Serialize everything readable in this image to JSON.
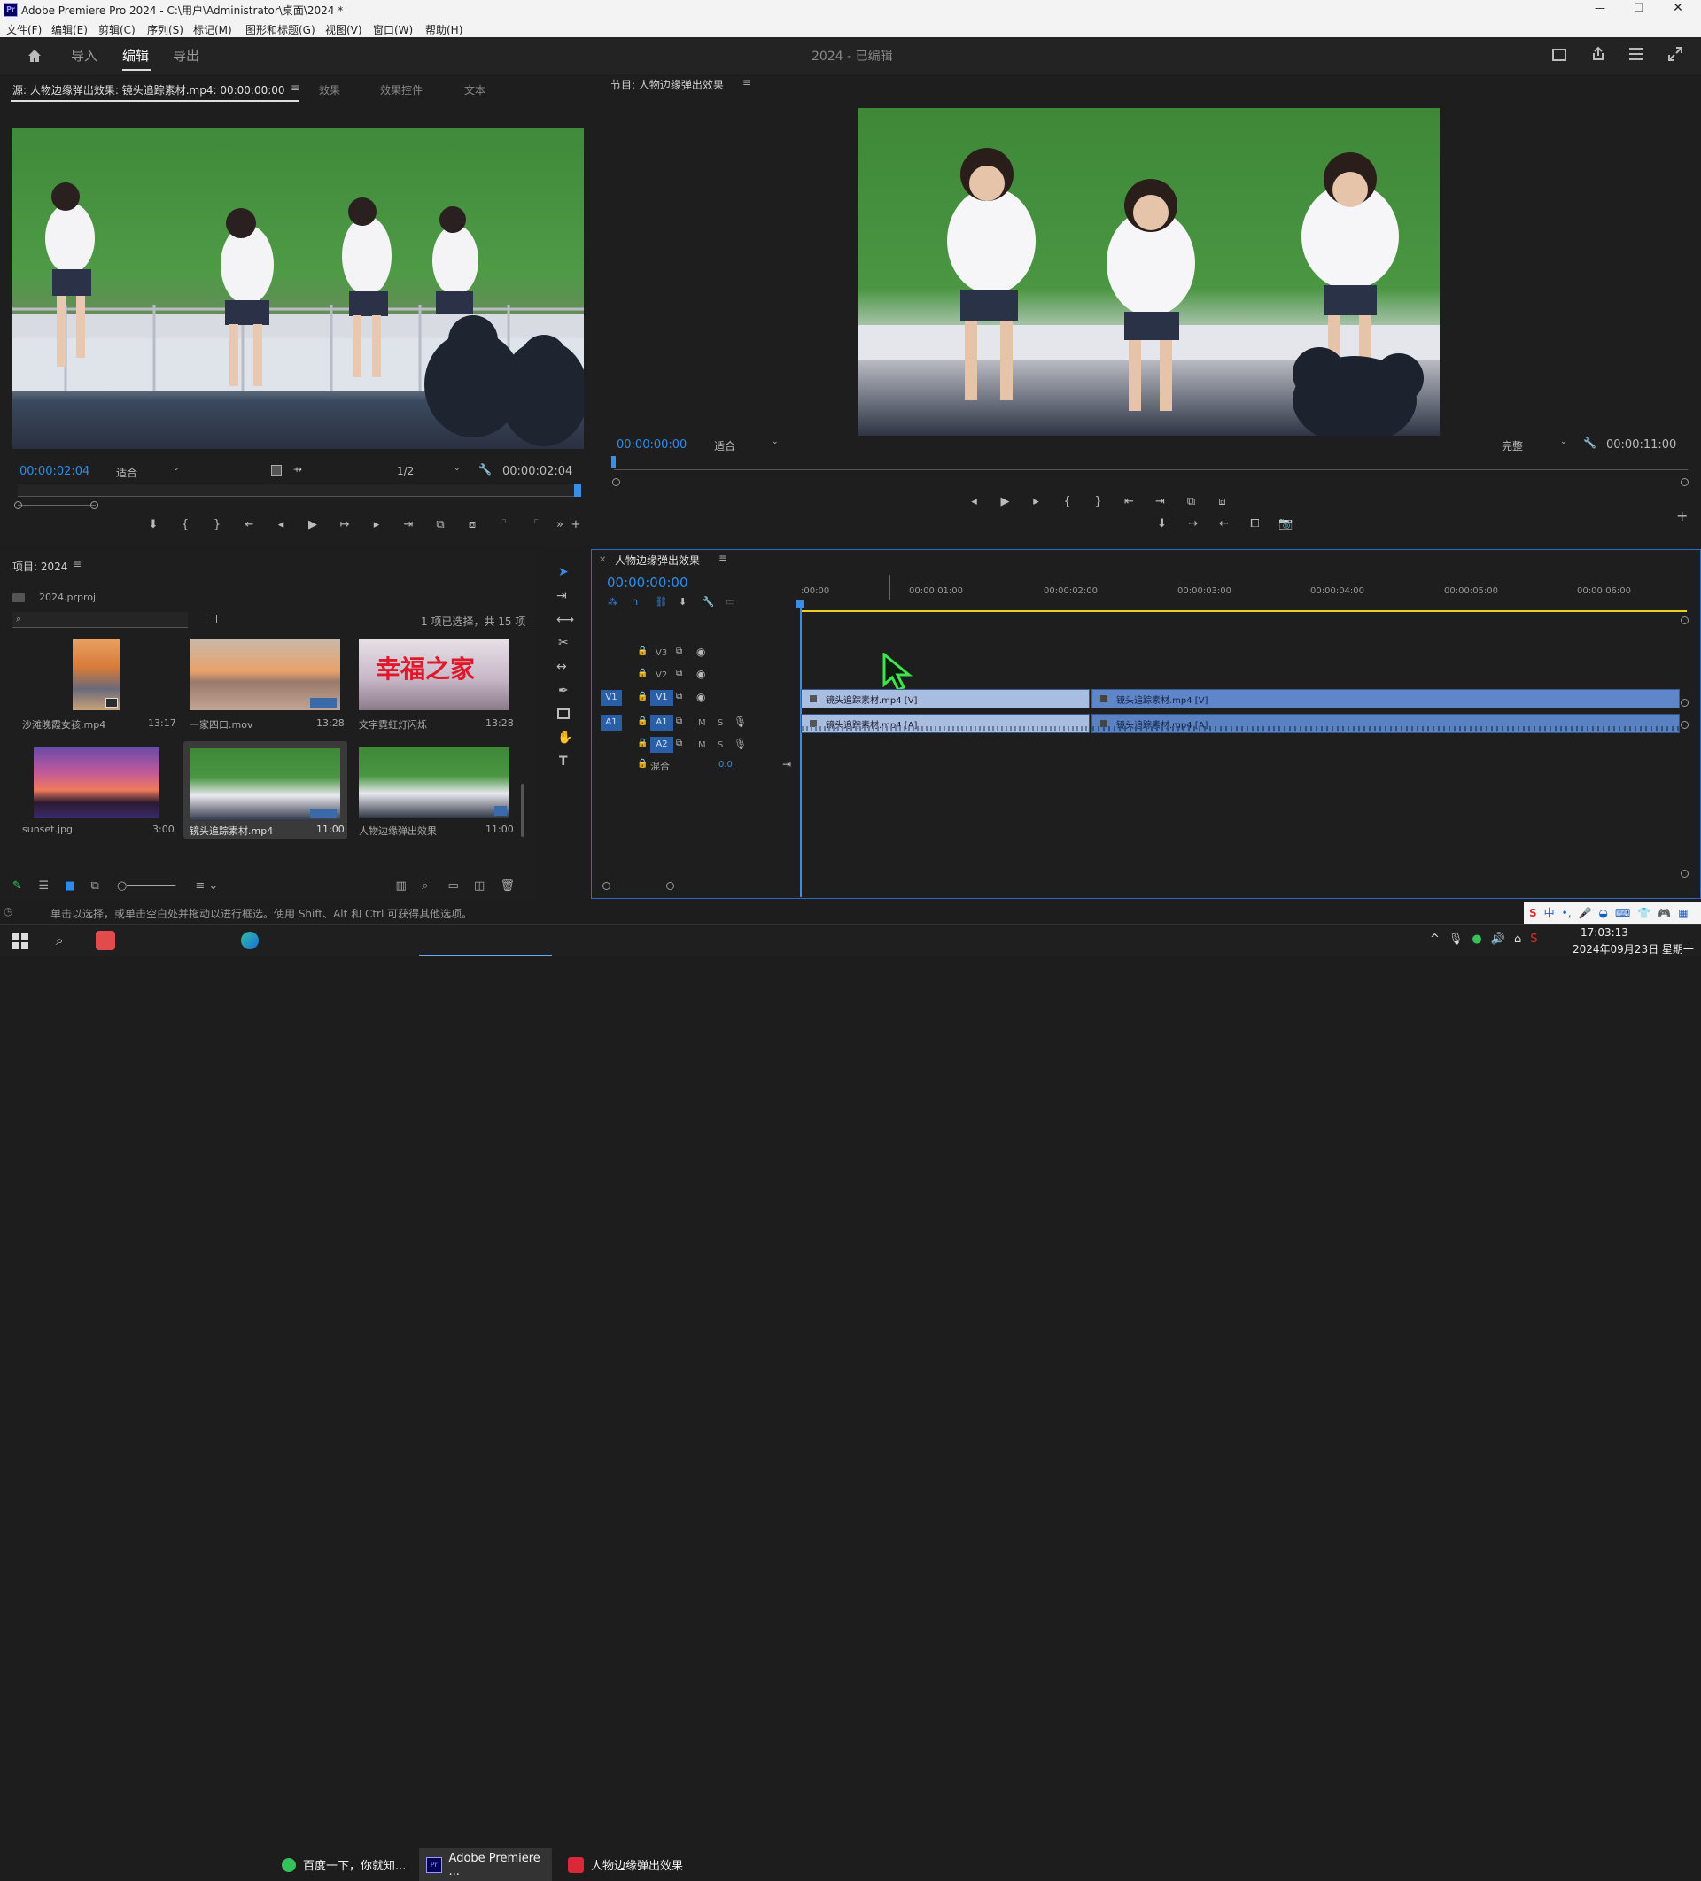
{
  "window": {
    "title": "Adobe Premiere Pro 2024 - C:\\用户\\Administrator\\桌面\\2024 *",
    "app_icon": "Pr"
  },
  "menu": [
    "文件(F)",
    "编辑(E)",
    "剪辑(C)",
    "序列(S)",
    "标记(M)",
    "图形和标题(G)",
    "视图(V)",
    "窗口(W)",
    "帮助(H)"
  ],
  "workspace": {
    "tabs": [
      "导入",
      "编辑",
      "导出"
    ],
    "active": "编辑",
    "project_status": "2024 - 已编辑"
  },
  "source": {
    "tabs": [
      "源: 人物边缘弹出效果: 镜头追踪素材.mp4: 00:00:00:00",
      "效果",
      "效果控件",
      "文本"
    ],
    "timecode": "00:00:02:04",
    "fit": "适合",
    "resolution": "1/2",
    "duration": "00:00:02:04"
  },
  "program": {
    "title": "节目: 人物边缘弹出效果",
    "timecode": "00:00:00:00",
    "fit": "适合",
    "quality": "完整",
    "duration": "00:00:11:00"
  },
  "project": {
    "title": "项目: 2024",
    "file": "2024.prproj",
    "selection": "1 项已选择，共 15 项",
    "search_placeholder": "",
    "items": [
      {
        "name": "沙滩晚霞女孩.mp4",
        "duration": "13:17"
      },
      {
        "name": "一家四口.mov",
        "duration": "13:28"
      },
      {
        "name": "文字霓虹灯闪烁",
        "duration": "13:28",
        "overlay": "幸福之家"
      },
      {
        "name": "sunset.jpg",
        "duration": "3:00"
      },
      {
        "name": "镜头追踪素材.mp4",
        "duration": "11:00"
      },
      {
        "name": "人物边缘弹出效果",
        "duration": "11:00"
      }
    ]
  },
  "timeline": {
    "title": "人物边缘弹出效果",
    "timecode": "00:00:00:00",
    "ruler": [
      ":00:00",
      "00:00:01:00",
      "00:00:02:00",
      "00:00:03:00",
      "00:00:04:00",
      "00:00:05:00",
      "00:00:06:00"
    ],
    "tracks": {
      "v3": "V3",
      "v2": "V2",
      "v1": "V1",
      "a1": "A1",
      "a2": "A2",
      "mix": "混合",
      "mix_val": "0.0",
      "m": "M",
      "s": "S",
      "src_v1": "V1",
      "src_a1": "A1"
    },
    "clips": {
      "v1_a": "镜头追踪素材.mp4 [V]",
      "v1_b": "镜头追踪素材.mp4 [V]",
      "a1_a": "镜头追踪素材.mp4 [A]",
      "a1_b": "镜头追踪素材.mp4 [A]"
    }
  },
  "statusbar": "单击以选择，或单击空白处并拖动以进行框选。使用 Shift、Alt 和 Ctrl 可获得其他选项。",
  "taskbar": {
    "items": [
      "百度一下，你就知...",
      "Adobe Premiere ...",
      "人物边缘弹出效果"
    ],
    "time": "17:03:13",
    "date": "2024年09月23日 星期一",
    "ime": "中"
  },
  "colors": {
    "accent": "#2d8ceb",
    "clip_video": "#5f86c8",
    "clip_audio": "#5a82c2",
    "playhead": "#3a8ee6",
    "work_area": "#e8d21d"
  }
}
